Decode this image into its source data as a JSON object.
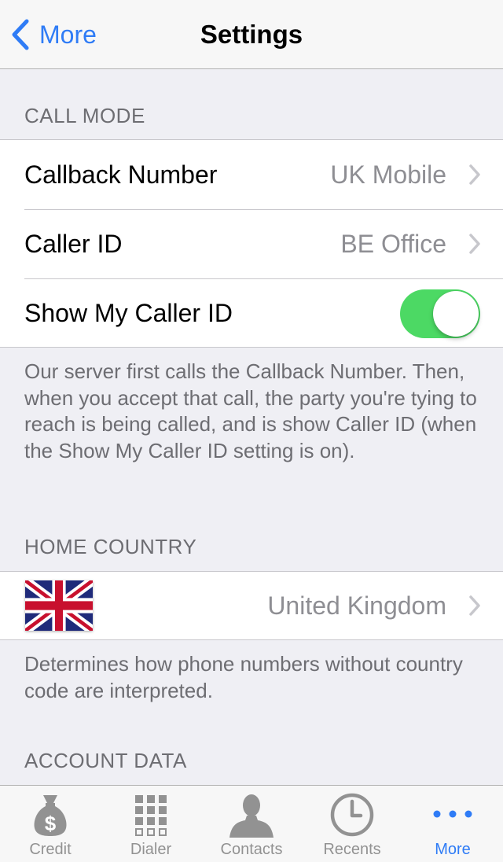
{
  "navbar": {
    "back_label": "More",
    "title": "Settings"
  },
  "call_mode": {
    "header": "CALL MODE",
    "rows": [
      {
        "label": "Callback Number",
        "value": "UK Mobile"
      },
      {
        "label": "Caller ID",
        "value": "BE Office"
      },
      {
        "label": "Show My Caller ID",
        "toggle_on": true
      }
    ],
    "footer": "Our server first calls the Callback Number. Then, when you accept that call, the party you're tying to reach is being called, and is show Caller ID (when the Show My Caller ID setting is on)."
  },
  "home_country": {
    "header": "HOME COUNTRY",
    "flag_icon": "uk-flag-icon",
    "value": "United Kingdom",
    "footer": "Determines how phone numbers without country code are interpreted."
  },
  "account_data": {
    "header": "ACCOUNT DATA"
  },
  "tabbar": {
    "tabs": [
      {
        "label": "Credit",
        "icon": "money-bag-icon",
        "active": false
      },
      {
        "label": "Dialer",
        "icon": "keypad-icon",
        "active": false
      },
      {
        "label": "Contacts",
        "icon": "person-icon",
        "active": false
      },
      {
        "label": "Recents",
        "icon": "clock-icon",
        "active": false
      },
      {
        "label": "More",
        "icon": "more-dots-icon",
        "active": true
      }
    ]
  },
  "colors": {
    "accent": "#2f7cf6",
    "toggle_on": "#4cd964",
    "background": "#efeff4",
    "secondary_text": "#8e8e93"
  }
}
